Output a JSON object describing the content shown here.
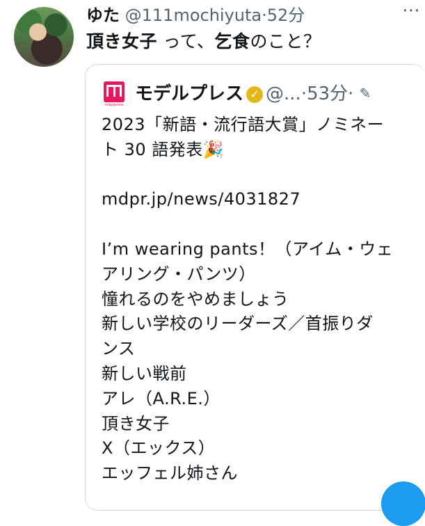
{
  "tweet": {
    "display_name": "ゆた",
    "handle": "@111mochiyuta",
    "separator": "·",
    "time": "52分",
    "more_label": "⋯",
    "text_parts": [
      "頂き女子",
      " って、",
      "乞食",
      "のこと？"
    ]
  },
  "quoted_tweet": {
    "logo_text": "mdprpress",
    "display_name": "モデルプレス",
    "verified_icon": "verified-badge-gold",
    "handle": "@...",
    "separator": "·",
    "time": "53分",
    "separator2": "·",
    "edit_icon": "edit-pencil-icon",
    "lines": [
      "2023「新語・流行語大賞」ノミネー",
      "ト 30 語発表🎉",
      "",
      "mdpr.jp/news/4031827",
      "",
      "I’m wearing pants！（アイム・ウェ",
      "アリング・パンツ）",
      "憧れるのをやめましょう",
      "新しい学校のリーダーズ／首振りダ",
      "ンス",
      "新しい戦前",
      "アレ（A.R.E.）",
      "頂き女子",
      "X（エックス）",
      "エッフェル姉さん"
    ]
  },
  "colors": {
    "accent": "#1d9bf0",
    "brand": "#e6195e",
    "verified": "#e2b719",
    "muted": "#536471"
  }
}
